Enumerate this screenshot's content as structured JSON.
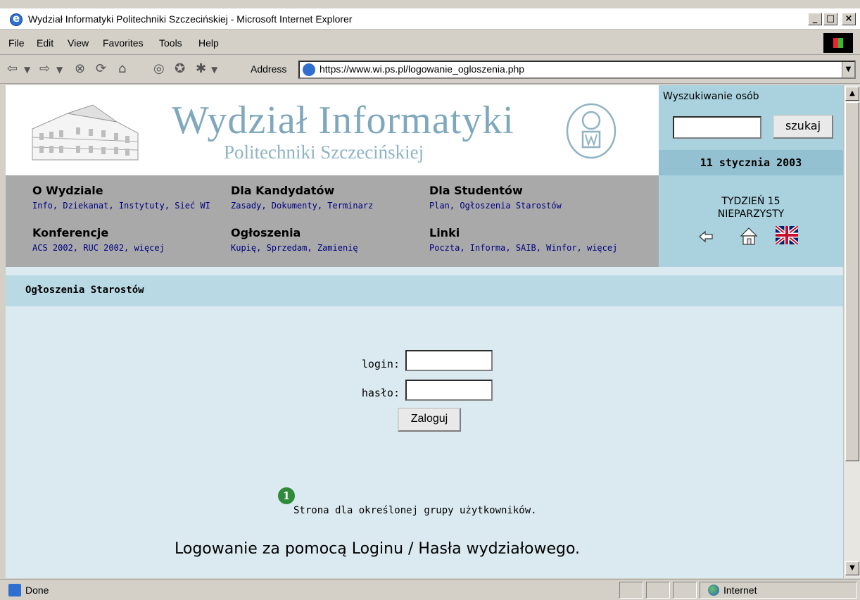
{
  "window": {
    "title": "Wydział Informatyki Politechniki Szczecińskiej - Microsoft Internet Explorer",
    "minimize": "_",
    "maximize": "□",
    "close": "×"
  },
  "menu": [
    "File",
    "Edit",
    "View",
    "Favorites",
    "Tools",
    "Help"
  ],
  "toolbar": {
    "address_label": "Address",
    "url": "https://www.wi.ps.pl/logowanie_ogloszenia.php"
  },
  "header": {
    "title": "Wydział Informatyki",
    "subtitle": "Politechniki Szczecińskiej"
  },
  "search": {
    "title": "Wyszukiwanie osób",
    "button": "szukaj",
    "value": ""
  },
  "date": "11 stycznia 2003",
  "week": {
    "line1": "TYDZIEŃ 15",
    "line2": "NIEPARZYSTY"
  },
  "nav": [
    {
      "heading": "O Wydziale",
      "links": "Info, Dziekanat, Instytuty, Sieć WI"
    },
    {
      "heading": "Dla Kandydatów",
      "links": "Zasady, Dokumenty, Terminarz"
    },
    {
      "heading": "Dla Studentów",
      "links": "Plan, Ogłoszenia Starostów"
    },
    {
      "heading": "Konferencje",
      "links": "ACS 2002, RUC 2002, więcej"
    },
    {
      "heading": "Ogłoszenia",
      "links": "Kupię, Sprzedam, Zamienię"
    },
    {
      "heading": "Linki",
      "links": "Poczta, Informa, SAIB, Winfor, więcej"
    }
  ],
  "section": {
    "title": "Ogłoszenia Starostów"
  },
  "form": {
    "login_label": "login:",
    "login_value": "",
    "password_label": "hasło:",
    "password_value": "",
    "submit": "Zaloguj"
  },
  "badge": "1",
  "notes": {
    "restricted": "Strona dla określonej grupy użytkowników.",
    "login_info": "Logowanie za pomocą Loginu / Hasła wydziałowego."
  },
  "status": {
    "text": "Done",
    "zone": "Internet"
  }
}
